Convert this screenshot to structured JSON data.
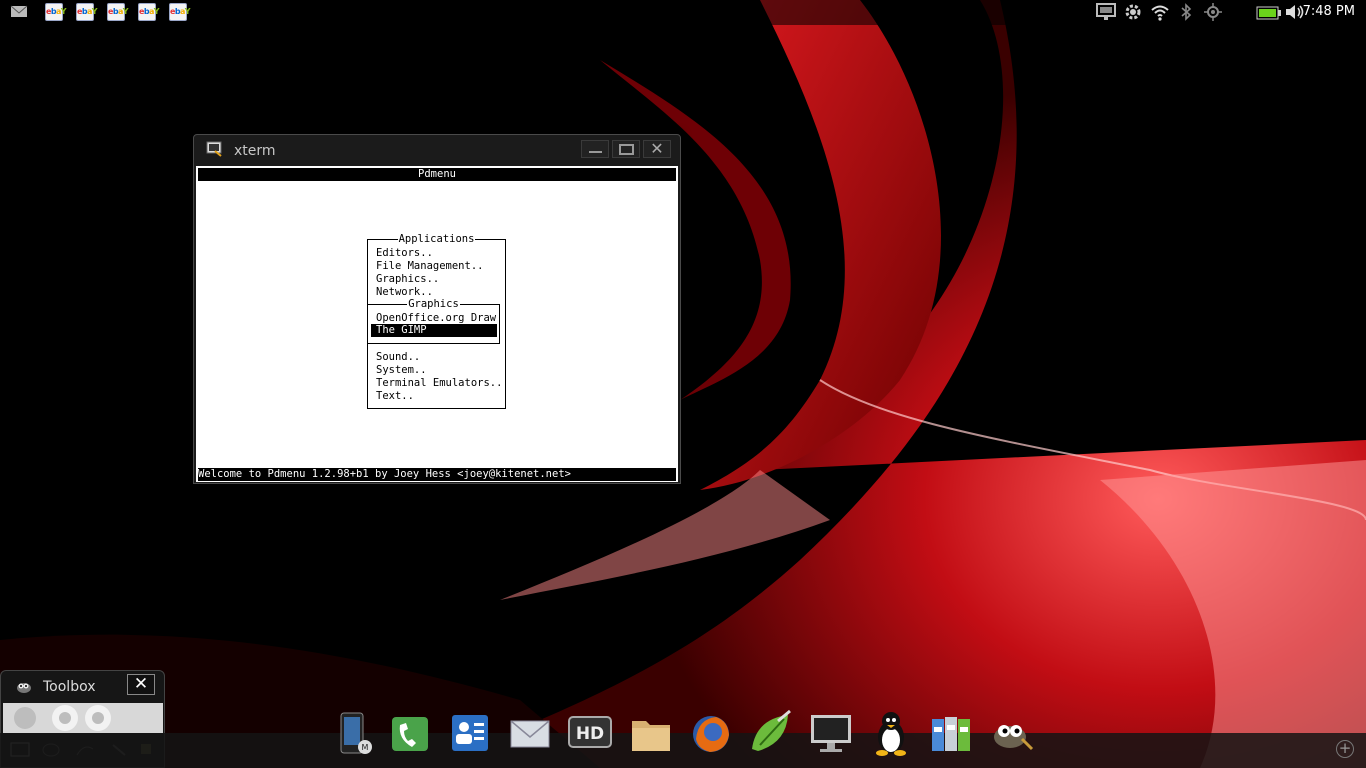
{
  "status_bar": {
    "notifications": [
      {
        "icon": "mail-icon"
      },
      {
        "icon": "ebay-icon",
        "text": [
          "e",
          "b",
          "a",
          "Y"
        ]
      },
      {
        "icon": "ebay-icon",
        "text": [
          "e",
          "b",
          "a",
          "Y"
        ]
      },
      {
        "icon": "ebay-icon",
        "text": [
          "e",
          "b",
          "a",
          "Y"
        ]
      },
      {
        "icon": "ebay-icon",
        "text": [
          "e",
          "b",
          "a",
          "Y"
        ]
      },
      {
        "icon": "ebay-icon",
        "text": [
          "e",
          "b",
          "a",
          "Y"
        ]
      }
    ],
    "system_icons": [
      "monitor-icon",
      "gear-icon",
      "wifi-icon",
      "bluetooth-icon",
      "gps-icon",
      "battery-icon",
      "volume-icon"
    ],
    "clock": "7:48 PM"
  },
  "xterm": {
    "title": "xterm",
    "header": "Pdmenu",
    "footer": "Welcome to Pdmenu 1.2.98+b1 by Joey Hess <joey@kitenet.net>",
    "applications_menu": {
      "title": "Applications",
      "items_before": [
        "Editors..",
        "File Management..",
        "Graphics..",
        "Network.."
      ],
      "items_after": [
        "Sound..",
        "System..",
        "Terminal Emulators..",
        "Text.."
      ]
    },
    "graphics_menu": {
      "title": "Graphics",
      "items": [
        "OpenOffice.org Draw",
        "The GIMP"
      ],
      "selected_index": 1
    }
  },
  "toolbox": {
    "title": "Toolbox",
    "close_label": "✕"
  },
  "dock": {
    "items": [
      "phone-device-icon",
      "dialer-icon",
      "contacts-icon",
      "email-icon",
      "hd-video-icon",
      "files-icon",
      "firefox-icon",
      "notes-icon",
      "desktop-icon",
      "linux-icon",
      "file-manager-icon",
      "gimp-icon"
    ],
    "hd_label": "HD",
    "add_label": "+"
  },
  "colors": {
    "wallpaper_red": "#c2141a",
    "selection": "#000000"
  }
}
